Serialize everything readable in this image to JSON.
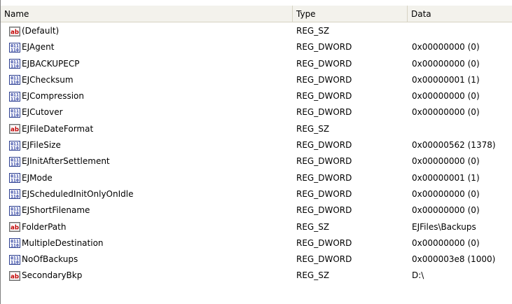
{
  "columns": {
    "name": "Name",
    "type": "Type",
    "data": "Data"
  },
  "rows": [
    {
      "name": "(Default)",
      "type": "REG_SZ",
      "data": "",
      "icon": "string-value-icon"
    },
    {
      "name": "EJAgent",
      "type": "REG_DWORD",
      "data": "0x00000000 (0)",
      "icon": "binary-value-icon"
    },
    {
      "name": "EJBACKUPECP",
      "type": "REG_DWORD",
      "data": "0x00000000 (0)",
      "icon": "binary-value-icon"
    },
    {
      "name": "EJChecksum",
      "type": "REG_DWORD",
      "data": "0x00000001 (1)",
      "icon": "binary-value-icon"
    },
    {
      "name": "EJCompression",
      "type": "REG_DWORD",
      "data": "0x00000000 (0)",
      "icon": "binary-value-icon"
    },
    {
      "name": "EJCutover",
      "type": "REG_DWORD",
      "data": "0x00000000 (0)",
      "icon": "binary-value-icon"
    },
    {
      "name": "EJFileDateFormat",
      "type": "REG_SZ",
      "data": "",
      "icon": "string-value-icon"
    },
    {
      "name": "EJFileSize",
      "type": "REG_DWORD",
      "data": "0x00000562 (1378)",
      "icon": "binary-value-icon"
    },
    {
      "name": "EJInitAfterSettlement",
      "type": "REG_DWORD",
      "data": "0x00000000 (0)",
      "icon": "binary-value-icon"
    },
    {
      "name": "EJMode",
      "type": "REG_DWORD",
      "data": "0x00000001 (1)",
      "icon": "binary-value-icon"
    },
    {
      "name": "EJScheduledInitOnlyOnIdle",
      "type": "REG_DWORD",
      "data": "0x00000000 (0)",
      "icon": "binary-value-icon"
    },
    {
      "name": "EJShortFilename",
      "type": "REG_DWORD",
      "data": "0x00000000 (0)",
      "icon": "binary-value-icon"
    },
    {
      "name": "FolderPath",
      "type": "REG_SZ",
      "data": "EJFiles\\Backups",
      "icon": "string-value-icon"
    },
    {
      "name": "MultipleDestination",
      "type": "REG_DWORD",
      "data": "0x00000000 (0)",
      "icon": "binary-value-icon"
    },
    {
      "name": "NoOfBackups",
      "type": "REG_DWORD",
      "data": "0x000003e8 (1000)",
      "icon": "binary-value-icon"
    },
    {
      "name": "SecondaryBkp",
      "type": "REG_SZ",
      "data": "D:\\",
      "icon": "string-value-icon"
    }
  ]
}
